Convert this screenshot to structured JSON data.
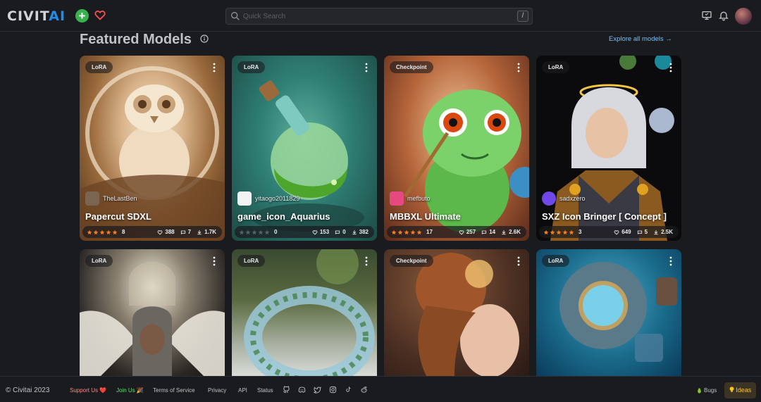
{
  "header": {
    "logo_left": "CIVIT",
    "logo_right": "AI",
    "search_placeholder": "Quick Search",
    "search_shortcut": "/"
  },
  "section": {
    "title": "Featured Models",
    "explore_link": "Explore all models  →"
  },
  "cards": [
    {
      "badge": "LoRA",
      "user": "TheLastBen",
      "name": "Papercut SDXL",
      "stars": 5,
      "rating_count": "8",
      "likes": "388",
      "comments": "7",
      "downloads": "1.7K"
    },
    {
      "badge": "LoRA",
      "user": "yitaogo2011829",
      "name": "game_icon_Aquarius",
      "stars": 0,
      "rating_count": "0",
      "likes": "153",
      "comments": "0",
      "downloads": "382"
    },
    {
      "badge": "Checkpoint",
      "user": "mefbuto",
      "name": "MBBXL Ultimate",
      "stars": 5,
      "rating_count": "17",
      "likes": "257",
      "comments": "14",
      "downloads": "2.6K"
    },
    {
      "badge": "LoRA",
      "user": "sadxzero",
      "name": "SXZ Icon Bringer [ Concept ]",
      "stars": 5,
      "rating_count": "3",
      "likes": "649",
      "comments": "5",
      "downloads": "2.5K"
    },
    {
      "badge": "LoRA"
    },
    {
      "badge": "LoRA"
    },
    {
      "badge": "Checkpoint"
    },
    {
      "badge": "LoRA"
    }
  ],
  "footer": {
    "copyright": "© Civitai 2023",
    "support": "Support Us ❤️",
    "join": "Join Us 🎉",
    "terms": "Terms of Service",
    "privacy": "Privacy",
    "api": "API",
    "status": "Status",
    "bugs": "Bugs",
    "ideas": "Ideas"
  },
  "colors": {
    "accent": "#228be6",
    "star": "#fd7e14",
    "support": "#ff8787",
    "join": "#69db7c",
    "ideas": "#fcc419"
  }
}
